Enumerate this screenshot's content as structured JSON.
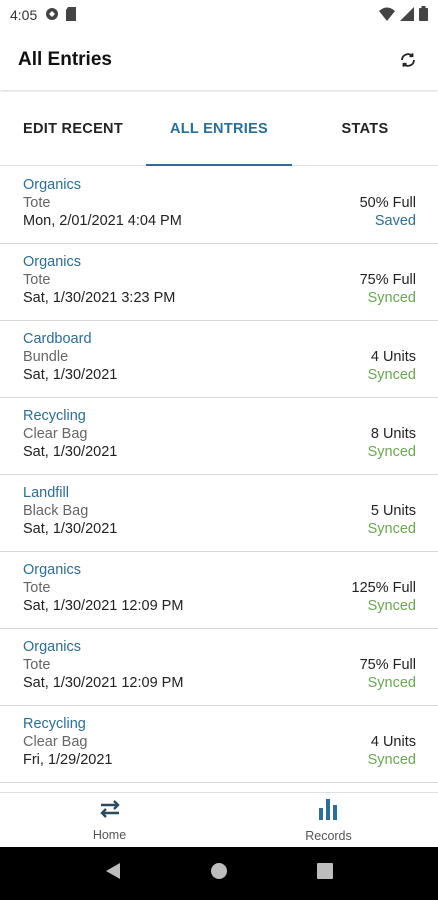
{
  "status_bar": {
    "time": "4:05"
  },
  "app_bar": {
    "title": "All Entries",
    "refresh_icon": "refresh-icon"
  },
  "tabs": [
    {
      "label": "EDIT RECENT",
      "active": false
    },
    {
      "label": "ALL ENTRIES",
      "active": true
    },
    {
      "label": "STATS",
      "active": false
    }
  ],
  "entries": [
    {
      "category": "Organics",
      "container": "Tote",
      "date": "Mon, 2/01/2021 4:04 PM",
      "amount": "50% Full",
      "status": "Saved"
    },
    {
      "category": "Organics",
      "container": "Tote",
      "date": "Sat, 1/30/2021 3:23 PM",
      "amount": "75% Full",
      "status": "Synced"
    },
    {
      "category": "Cardboard",
      "container": "Bundle",
      "date": "Sat, 1/30/2021",
      "amount": "4 Units",
      "status": "Synced"
    },
    {
      "category": "Recycling",
      "container": "Clear Bag",
      "date": "Sat, 1/30/2021",
      "amount": "8 Units",
      "status": "Synced"
    },
    {
      "category": "Landfill",
      "container": "Black Bag",
      "date": "Sat, 1/30/2021",
      "amount": "5 Units",
      "status": "Synced"
    },
    {
      "category": "Organics",
      "container": "Tote",
      "date": "Sat, 1/30/2021 12:09 PM",
      "amount": "125% Full",
      "status": "Synced"
    },
    {
      "category": "Organics",
      "container": "Tote",
      "date": "Sat, 1/30/2021 12:09 PM",
      "amount": "75% Full",
      "status": "Synced"
    },
    {
      "category": "Recycling",
      "container": "Clear Bag",
      "date": "Fri, 1/29/2021",
      "amount": "4 Units",
      "status": "Synced"
    }
  ],
  "bottom_nav": {
    "home": {
      "label": "Home",
      "icon": "swap-arrows-icon"
    },
    "records": {
      "label": "Records",
      "icon": "bar-chart-icon"
    }
  },
  "colors": {
    "accent": "#2a6f97",
    "synced": "#6aa84f",
    "system_nav": "#000000"
  }
}
